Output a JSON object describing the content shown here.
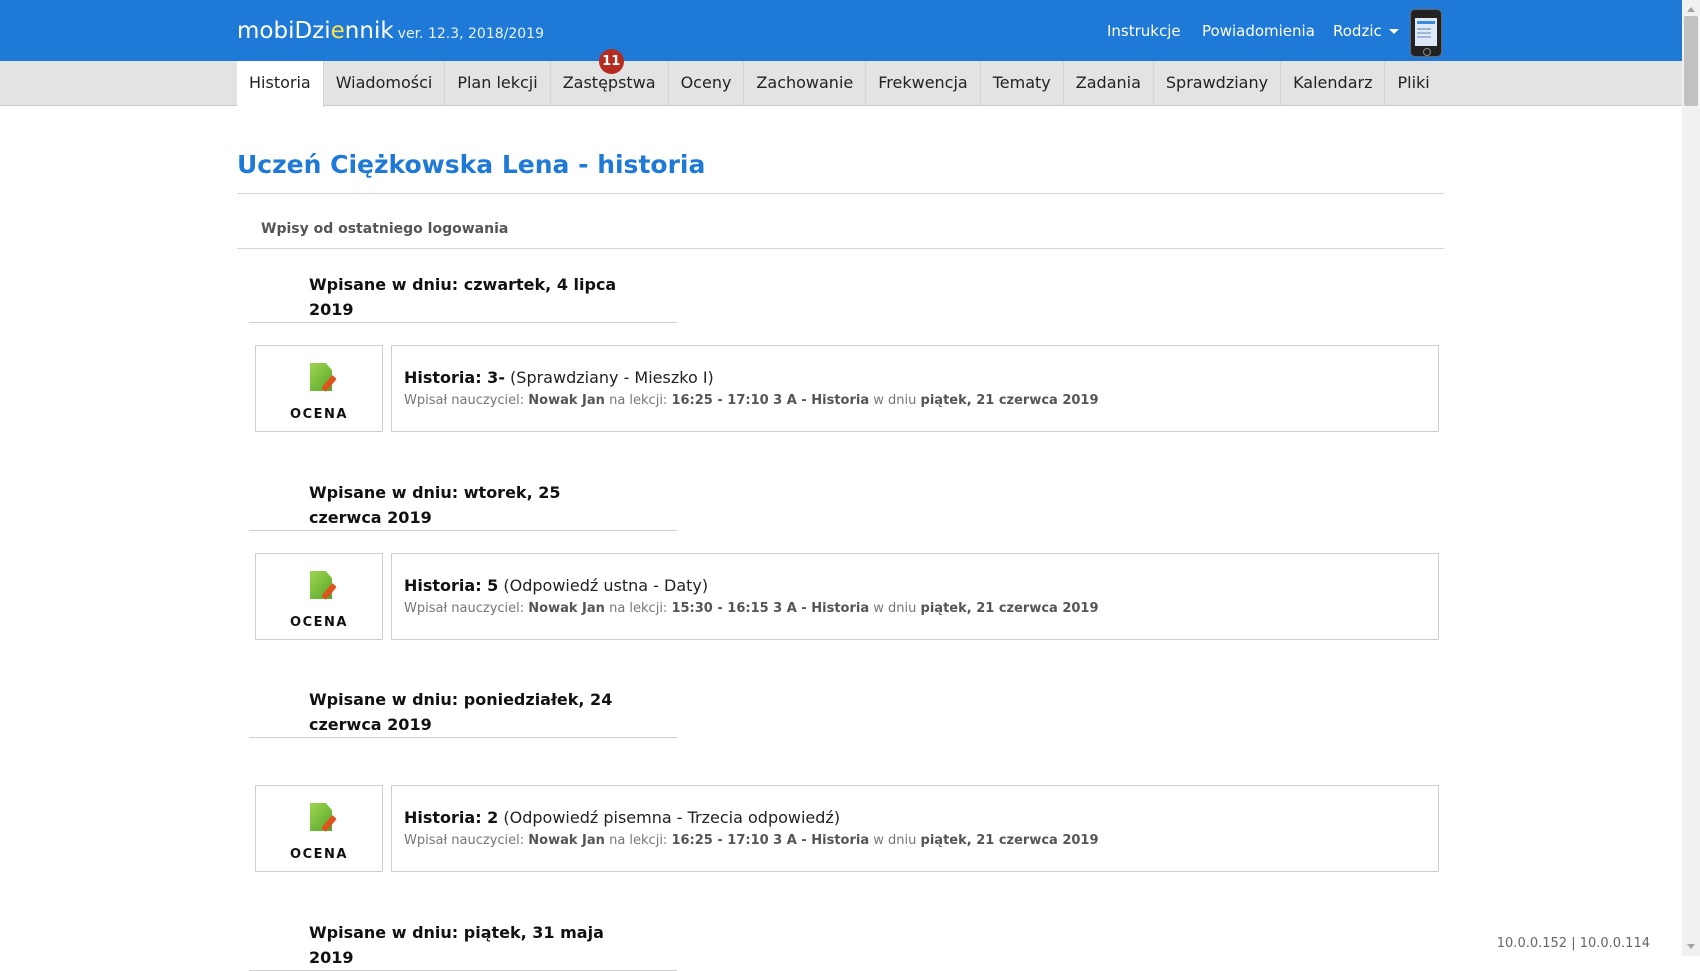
{
  "header": {
    "brand_name_a": "mobiDzi",
    "brand_name_mark": "e",
    "brand_name_b": "nnik",
    "version": "ver. 12.3, 2018/2019",
    "nav": [
      "Instrukcje",
      "Powiadomienia"
    ],
    "user_menu": "Rodzic"
  },
  "tabs": [
    {
      "label": "Historia",
      "active": true
    },
    {
      "label": "Wiadomości"
    },
    {
      "label": "Plan lekcji"
    },
    {
      "label": "Zastępstwa",
      "badge": "11"
    },
    {
      "label": "Oceny"
    },
    {
      "label": "Zachowanie"
    },
    {
      "label": "Frekwencja"
    },
    {
      "label": "Tematy"
    },
    {
      "label": "Zadania"
    },
    {
      "label": "Sprawdziany"
    },
    {
      "label": "Kalendarz"
    },
    {
      "label": "Pliki"
    }
  ],
  "page": {
    "title": "Uczeń Ciężkowska Lena - historia",
    "subtitle": "Wpisy od ostatniego logowania"
  },
  "groups": [
    {
      "date_label": "Wpisane w dniu: czwartek, 4 lipca 2019",
      "entries": [
        {
          "icon_label": "OCENA",
          "subject_grade": "Historia: 3-",
          "detail": "(Sprawdziany - Mieszko I)",
          "teacher_prefix": "Wpisał nauczyciel:",
          "teacher": "Nowak Jan",
          "lesson_prefix": "na lekcji:",
          "lesson": "16:25 - 17:10 3 A - Historia",
          "date_prefix": "w dniu",
          "date": "piątek, 21 czerwca 2019"
        }
      ]
    },
    {
      "date_label": "Wpisane w dniu: wtorek, 25 czerwca 2019",
      "entries": [
        {
          "icon_label": "OCENA",
          "subject_grade": "Historia: 5",
          "detail": "(Odpowiedź ustna - Daty)",
          "teacher_prefix": "Wpisał nauczyciel:",
          "teacher": "Nowak Jan",
          "lesson_prefix": "na lekcji:",
          "lesson": "15:30 - 16:15 3 A - Historia",
          "date_prefix": "w dniu",
          "date": "piątek, 21 czerwca 2019"
        }
      ]
    },
    {
      "date_label": "Wpisane w dniu: poniedziałek, 24 czerwca 2019",
      "entries": [
        {
          "icon_label": "OCENA",
          "subject_grade": "Historia: 2",
          "detail": "(Odpowiedź pisemna - Trzecia odpowiedź)",
          "teacher_prefix": "Wpisał nauczyciel:",
          "teacher": "Nowak Jan",
          "lesson_prefix": "na lekcji:",
          "lesson": "16:25 - 17:10 3 A - Historia",
          "date_prefix": "w dniu",
          "date": "piątek, 21 czerwca 2019"
        }
      ]
    },
    {
      "date_label": "Wpisane w dniu: piątek, 31 maja 2019",
      "entries": []
    }
  ],
  "footer": {
    "ip": "10.0.0.152 | 10.0.0.114"
  }
}
